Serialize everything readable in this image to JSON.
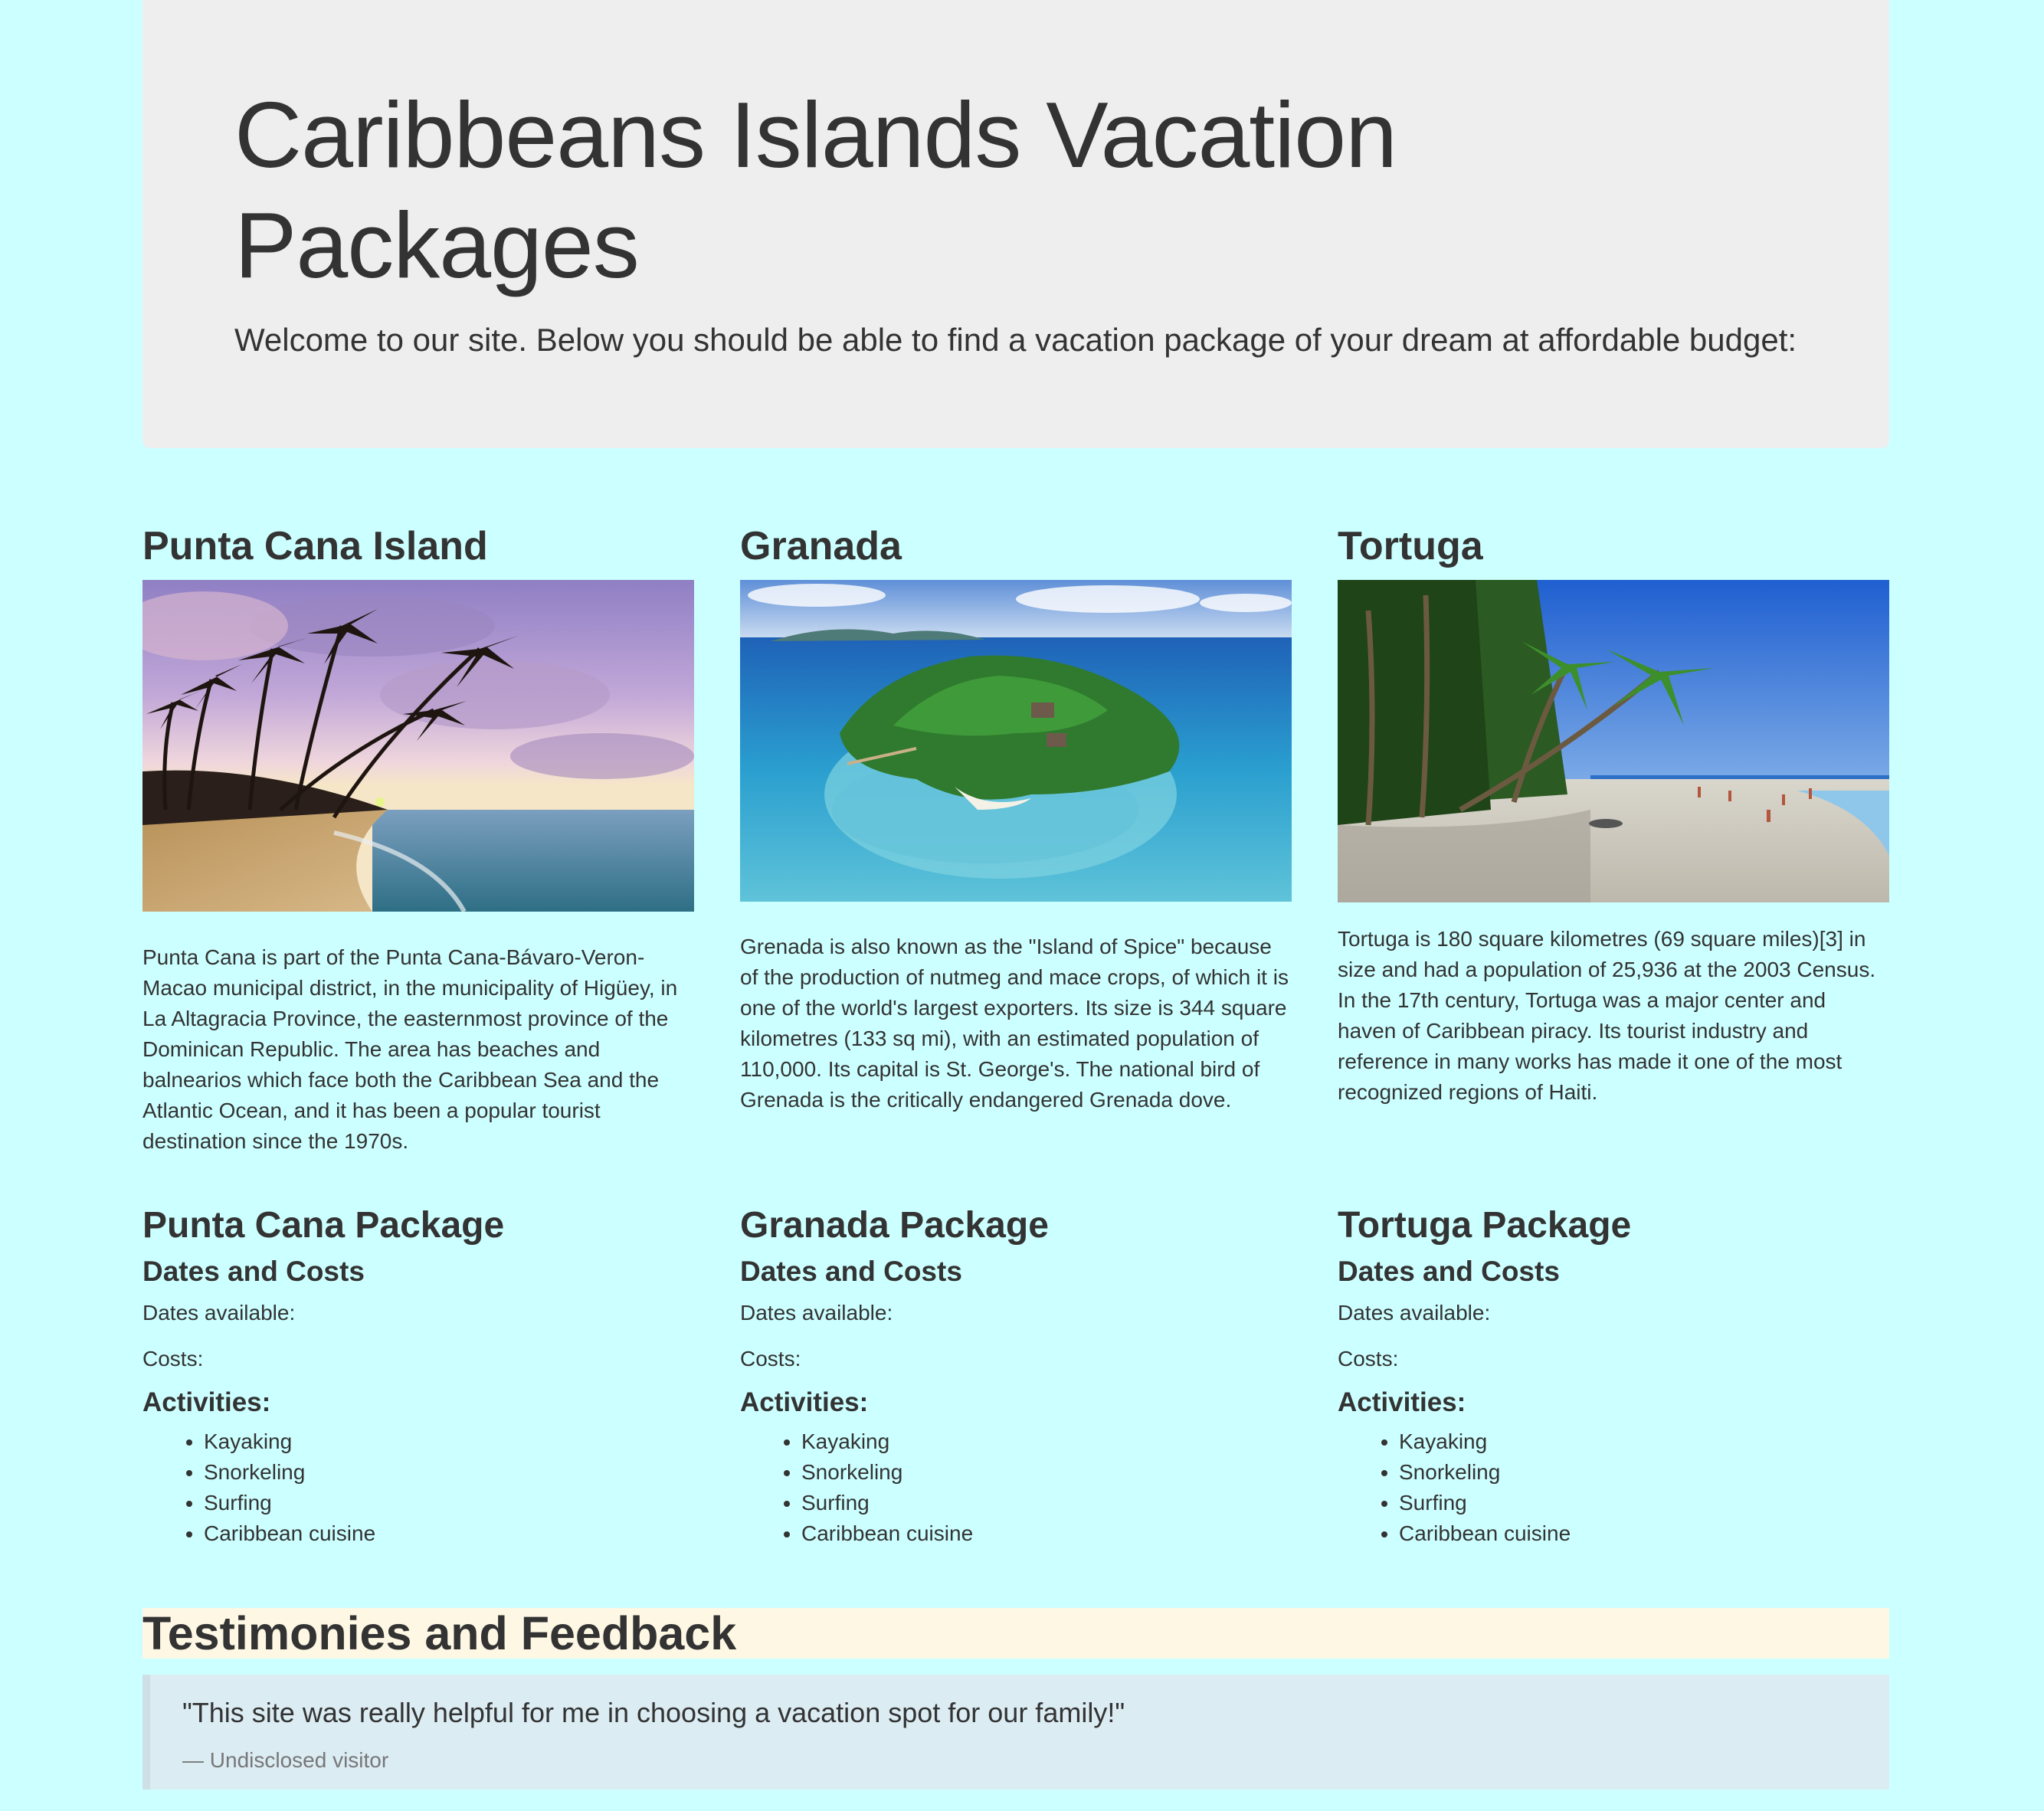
{
  "header": {
    "title": "Caribbeans Islands Vacation Packages",
    "welcome": "Welcome to our site. Below you should be able to find a vacation package of your dream at affordable budget:"
  },
  "islands": [
    {
      "name": "Punta Cana Island",
      "description": "Punta Cana is part of the Punta Cana-Bávaro-Veron-Macao municipal district, in the municipality of Higüey, in La Altagracia Province, the easternmost province of the Dominican Republic. The area has beaches and balnearios which face both the Caribbean Sea and the Atlantic Ocean, and it has been a popular tourist destination since the 1970s.",
      "package_title": "Punta Cana Package",
      "dates_costs_heading": "Dates and Costs",
      "dates_label": "Dates available:",
      "costs_label": "Costs:",
      "activities_heading": "Activities:",
      "activities": [
        "Kayaking",
        "Snorkeling",
        "Surfing",
        "Caribbean cuisine"
      ]
    },
    {
      "name": "Granada",
      "description": "Grenada is also known as the \"Island of Spice\" because of the production of nutmeg and mace crops, of which it is one of the world's largest exporters. Its size is 344 square kilometres (133 sq mi), with an estimated population of 110,000. Its capital is St. George's. The national bird of Grenada is the critically endangered Grenada dove.",
      "package_title": "Granada Package",
      "dates_costs_heading": "Dates and Costs",
      "dates_label": "Dates available:",
      "costs_label": "Costs:",
      "activities_heading": "Activities:",
      "activities": [
        "Kayaking",
        "Snorkeling",
        "Surfing",
        "Caribbean cuisine"
      ]
    },
    {
      "name": "Tortuga",
      "description": "Tortuga is 180 square kilometres (69 square miles)[3] in size and had a population of 25,936 at the 2003 Census. In the 17th century, Tortuga was a major center and haven of Caribbean piracy. Its tourist industry and reference in many works has made it one of the most recognized regions of Haiti.",
      "package_title": "Tortuga Package",
      "dates_costs_heading": "Dates and Costs",
      "dates_label": "Dates available:",
      "costs_label": "Costs:",
      "activities_heading": "Activities:",
      "activities": [
        "Kayaking",
        "Snorkeling",
        "Surfing",
        "Caribbean cuisine"
      ]
    }
  ],
  "testimonies": {
    "heading": "Testimonies and Feedback",
    "quote": "\"This site was really helpful for me in choosing a vacation spot for our family!\"",
    "author": "— Undisclosed visitor"
  }
}
